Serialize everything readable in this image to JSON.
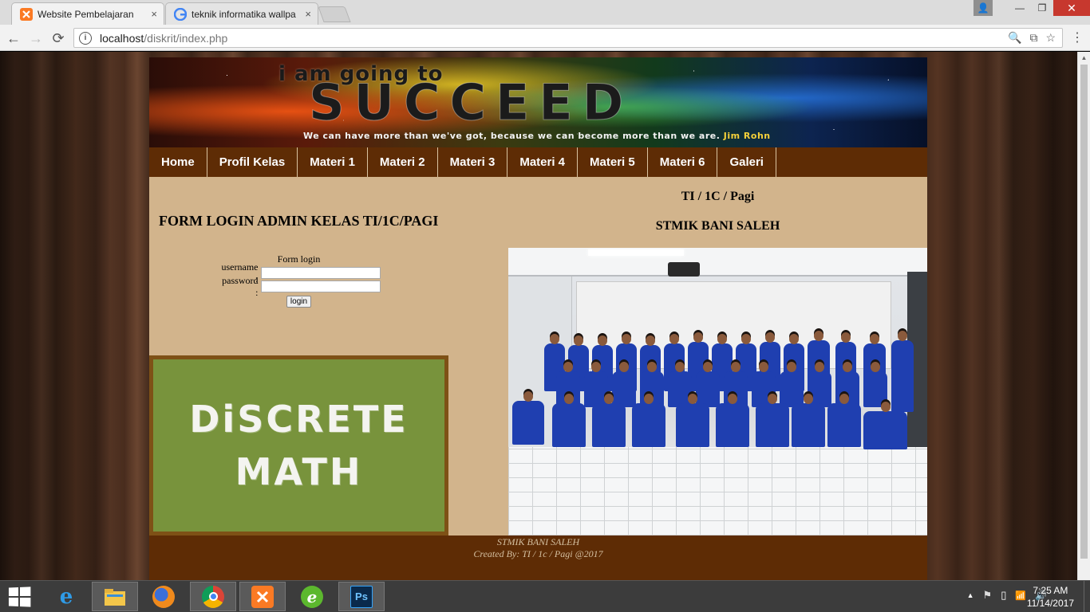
{
  "browser": {
    "tabs": [
      {
        "title": "Website Pembelajaran",
        "close": "×",
        "active": true
      },
      {
        "title": "teknik informatika wallpa",
        "close": "×",
        "active": false
      }
    ],
    "url_host": "localhost",
    "url_path": "/diskrit/index.php",
    "nav": {
      "back": "←",
      "forward": "→",
      "reload": "⟳",
      "info": "i"
    },
    "omni_icons": {
      "zoom": "🔍",
      "translate": "⧉",
      "star": "☆"
    },
    "menu": "⋮",
    "window_controls": {
      "user": "👤",
      "minimize": "—",
      "maximize": "❐",
      "close": "✕"
    }
  },
  "site": {
    "banner": {
      "line1": "i am going to",
      "line2": "SUCCEED",
      "quote": "We can have more than we've got, because we can become more than we are.",
      "author": "Jim Rohn"
    },
    "nav": [
      "Home",
      "Profil Kelas",
      "Materi 1",
      "Materi 2",
      "Materi 3",
      "Materi 4",
      "Materi 5",
      "Materi 6",
      "Galeri"
    ],
    "login": {
      "heading": "FORM LOGIN ADMIN KELAS TI/1C/PAGI",
      "caption": "Form login",
      "username_label": "username :",
      "password_label": "password :",
      "username_value": "",
      "password_value": "",
      "button": "login"
    },
    "chalkboard": {
      "line1": "DiSCRETE",
      "line2": "MATH"
    },
    "right": {
      "class_title": "TI / 1C / Pagi",
      "school_title": "STMIK BANI SALEH"
    },
    "footer": {
      "line1": "STMIK BANI SALEH",
      "line2": "Created By: TI / 1c / Pagi @2017"
    }
  },
  "taskbar": {
    "apps": [
      {
        "name": "internet-explorer",
        "label": "e",
        "open": false
      },
      {
        "name": "file-explorer",
        "label": "🗂",
        "open": true
      },
      {
        "name": "firefox",
        "label": "",
        "open": false
      },
      {
        "name": "chrome",
        "label": "",
        "open": true
      },
      {
        "name": "xampp",
        "label": "⌘",
        "open": true
      },
      {
        "name": "dreamweaver",
        "label": "e",
        "open": false
      },
      {
        "name": "photoshop",
        "label": "Ps",
        "open": true
      }
    ],
    "tray": {
      "up": "▲",
      "flag": "⚑",
      "battery": "▯",
      "network": "📶",
      "volume": "🔊"
    },
    "time": "7:25 AM",
    "date": "11/14/2017"
  },
  "colors": {
    "nav_bg": "#5e2c05",
    "content_bg": "#d2b48c",
    "chalkboard": "#78933c",
    "chalk_frame": "#7e5116",
    "footer_text": "#d4bfa0"
  }
}
